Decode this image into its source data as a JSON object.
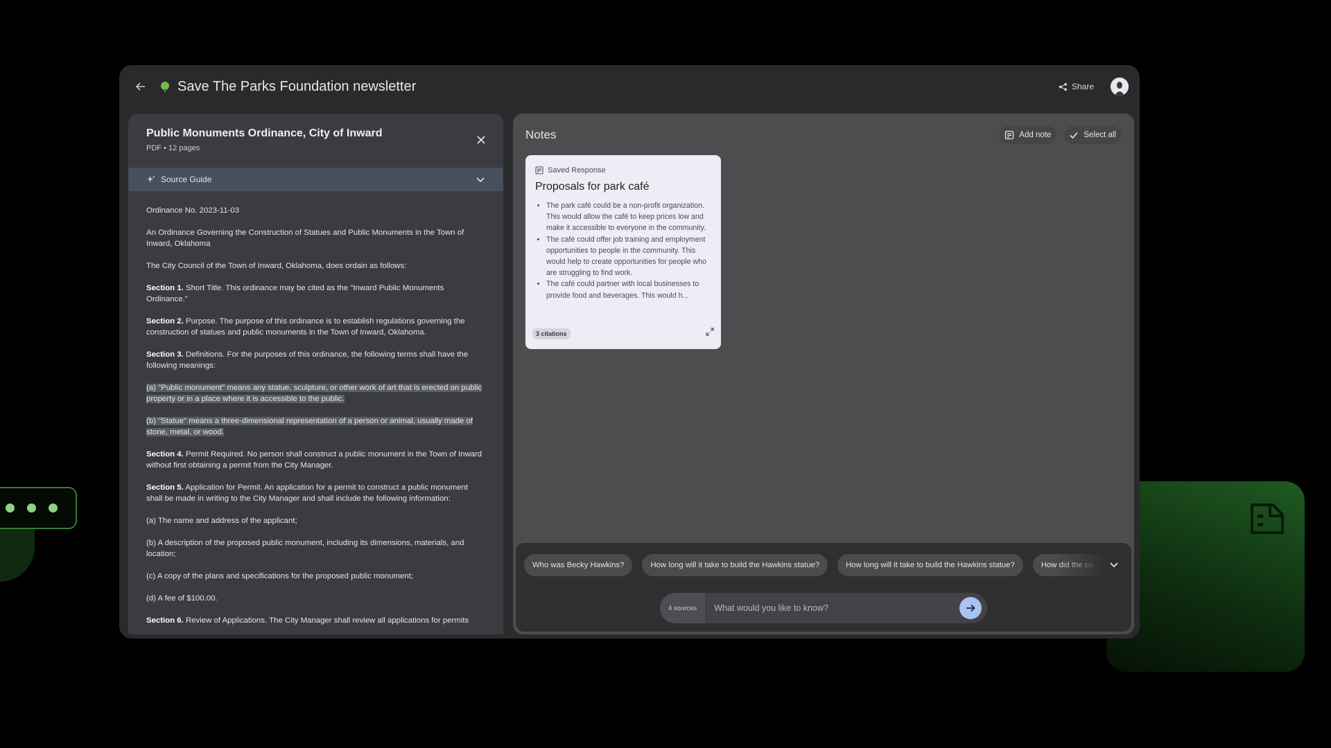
{
  "header": {
    "title": "Save The Parks Foundation newsletter",
    "share_label": "Share"
  },
  "source": {
    "title": "Public Monuments Ordinance, City of Inward",
    "meta": "PDF • 12 pages",
    "guide_label": "Source Guide",
    "paragraphs": {
      "p0": "Ordinance No. 2023-11-03",
      "p1": "An Ordinance Governing the Construction of Statues and Public Monuments in the Town of Inward, Oklahoma",
      "p2": "The City Council of the Town of Inward, Oklahoma, does ordain as follows:",
      "s1_head": "Section 1.",
      "s1_text": " Short Title. This ordinance may be cited as the \"Inward Public Monuments Ordinance.\"",
      "s2_head": "Section 2.",
      "s2_text": " Purpose. The purpose of this ordinance is to establish regulations governing the construction of statues and public monuments in the Town of Inward, Oklahoma.",
      "s3_head": "Section 3.",
      "s3_text": " Definitions. For the purposes of this ordinance, the following terms shall have the following meanings:",
      "s3a": "(a) \"Public monument\" means any statue, sculpture, or other work of art that is erected on public property or in a place where it is accessible to the public.",
      "s3b": "(b) \"Statue\" means a three-dimensional representation of a person or animal, usually made of stone, metal, or wood.",
      "s4_head": "Section 4.",
      "s4_text": " Permit Required. No person shall construct a public monument in the Town of Inward without first obtaining a permit from the City Manager.",
      "s5_head": "Section 5.",
      "s5_text": " Application for Permit. An application for a permit to construct a public monument shall be made in writing to the City Manager and shall include the following information:",
      "s5a": "(a) The name and address of the applicant;",
      "s5b": "(b) A description of the proposed public monument, including its dimensions, materials, and location;",
      "s5c": "(c) A copy of the plans and specifications for the proposed public monument;",
      "s5d": "(d) A fee of $100.00.",
      "s6_head": "Section 6.",
      "s6_text": " Review of Applications. The City Manager shall review all applications for permits"
    }
  },
  "notes": {
    "title": "Notes",
    "add_note_label": "Add note",
    "select_all_label": "Select all",
    "card": {
      "kind": "Saved Response",
      "title": "Proposals for park café",
      "bullets": [
        "The park café could be a non-profit organization. This would allow the café to keep prices low and make it accessible to everyone in the community.",
        "The café could offer job training and employment opportunities to people in the community. This would help to create opportunities for people who are struggling to find work.",
        "The café could partner with local businesses to provide food and beverages. This would h..."
      ],
      "citations": "3 citations"
    }
  },
  "chat": {
    "suggestions": [
      "Who was Becky Hawkins?",
      "How long will it take to build the Hawkins statue?",
      "How long will it take to build the Hawkins statue?",
      "How did the co"
    ],
    "sources_count": "4 sources",
    "placeholder": "What would you like to know?"
  },
  "colors": {
    "accent_send": "#a9c3f3",
    "brand_green": "#4caf50"
  }
}
